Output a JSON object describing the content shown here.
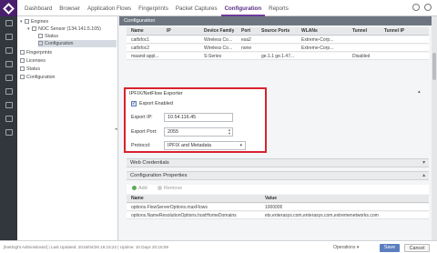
{
  "nav": {
    "tabs": [
      "Dashboard",
      "Browser",
      "Application Flows",
      "Fingerprints",
      "Packet Captures",
      "Configuration",
      "Reports"
    ],
    "active_tab": "Configuration"
  },
  "tree": {
    "engines": "Engines",
    "sensor": "NOC Sensor (134.141.5.105)",
    "status": "Status",
    "configuration": "Configuration",
    "fingerprints": "Fingerprints",
    "licenses": "Licenses",
    "status2": "Status",
    "configuration2": "Configuration"
  },
  "main": {
    "header": "Configuration",
    "table": {
      "columns": [
        "Name",
        "IP",
        "Device Family",
        "Port",
        "Source Ports",
        "WLANs",
        "Tunnel",
        "Tunnel IP"
      ],
      "rows": [
        [
          "catfsfoc1",
          "",
          "Wireless Co...",
          "esa2",
          "",
          "Extreme-Corp...",
          "",
          ""
        ],
        [
          "catfsfoc2",
          "",
          "Wireless Co...",
          "none",
          "",
          "Extreme-Corp...",
          "",
          ""
        ],
        [
          "maand-appl...",
          "",
          "S-Series",
          "",
          "ge.1.1 ge.1.47...",
          "",
          "Disabled",
          ""
        ]
      ]
    },
    "ipfix": {
      "title": "IPFIX/NetFlow Exporter",
      "export_enabled_label": "Export Enabled",
      "export_ip_label": "Export IP:",
      "export_ip_value": "10.54.116.45",
      "export_port_label": "Export Port:",
      "export_port_value": "2055",
      "protocol_label": "Protocol:",
      "protocol_value": "IPFIX and Metadata"
    },
    "web_credentials": "Web Credentials",
    "config_properties": {
      "title": "Configuration Properties",
      "add": "Add",
      "remove": "Remove",
      "columns": [
        "Name",
        "Value"
      ],
      "rows": [
        [
          "options.FlowServerOptions.maxFlows",
          "1000000"
        ],
        [
          "options.NameResolutionOptions.hostHomeDomains",
          "ets.enterasys.com,enterasys.com,extremenetworks.com"
        ]
      ]
    }
  },
  "footer": {
    "status": "[NetSight Administrator]  |  Last Updated: 2018/04/26 16:15:22  |  Uptime: 10 Days 20:15:09",
    "operations": "Operations",
    "save": "Save",
    "cancel": "Cancel"
  },
  "colors": {
    "accent": "#6e3a9a",
    "highlight_box": "#d9232e",
    "save_button": "#5b7fbf"
  }
}
